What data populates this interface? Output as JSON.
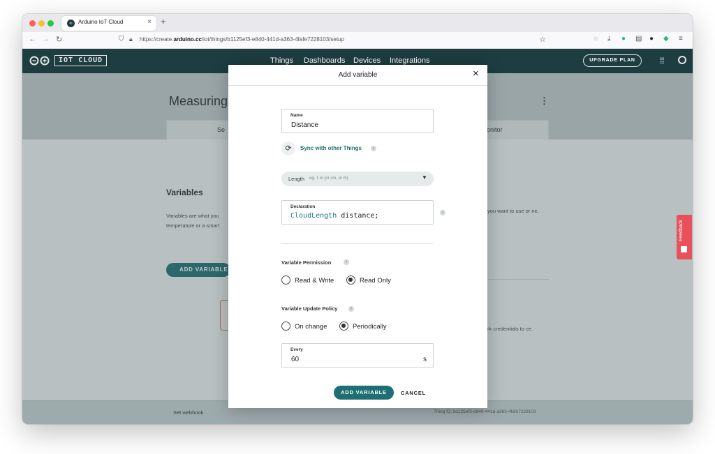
{
  "browser": {
    "tab_title": "Arduino IoT Cloud",
    "tab_close": "×",
    "new_tab": "+",
    "url_prefix": "https://create.",
    "url_domain": "arduino.cc",
    "url_path": "/iot/things/b1125ef3-e840-441d-a363-4fafe7228103/setup"
  },
  "app": {
    "logo_text": "IOT CLOUD",
    "nav": [
      "Things",
      "Dashboards",
      "Devices",
      "Integrations"
    ],
    "upgrade_label": "UPGRADE PLAN",
    "thing_title_visible": "Measuring",
    "tabs": {
      "setup_visible": "Se",
      "monitor_visible": "onitor"
    },
    "variables_heading": "Variables",
    "variables_desc_left": "Variables are what you temperature or a smart",
    "variables_desc_right": "you want to use or ne.",
    "add_variable_bg": "ADD VARIABLE",
    "credentials_text": "rk credentials to ce.",
    "footer": {
      "set_webhook": "Set webhook",
      "thing_id": "Thing ID: b1125ef3-e840-441d-a363-4fafe7228103"
    },
    "feedback_label": "Feedback"
  },
  "modal": {
    "title": "Add variable",
    "close_icon": "×",
    "name": {
      "label": "Name",
      "value": "Distance"
    },
    "sync_label": "Sync with other Things",
    "type": {
      "value": "Length",
      "hint": "eg. 1 in (or cm, or m)"
    },
    "declaration": {
      "label": "Declaration",
      "type_token": "CloudLength",
      "name_token": " distance;"
    },
    "permission": {
      "title": "Variable Permission",
      "options": [
        "Read & Write",
        "Read Only"
      ],
      "selected": "Read Only"
    },
    "update_policy": {
      "title": "Variable Update Policy",
      "options": [
        "On change",
        "Periodically"
      ],
      "selected": "Periodically"
    },
    "every": {
      "label": "Every",
      "value": "60",
      "unit": "s"
    },
    "add_button": "ADD VARIABLE",
    "cancel_button": "CANCEL"
  },
  "colors": {
    "brand_dark": "#1d3d40",
    "accent_teal": "#1f6f72",
    "feedback_red": "#e8505b"
  }
}
